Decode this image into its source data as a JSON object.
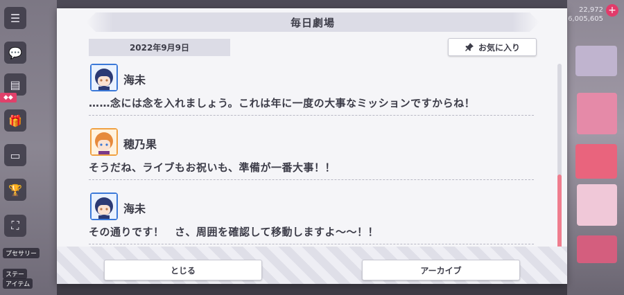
{
  "dialog": {
    "title": "毎日劇場",
    "date": "2022年9月9日",
    "favorite_label": "お気に入り",
    "close_label": "とじる",
    "archive_label": "アーカイブ"
  },
  "entries": [
    {
      "speaker": "海未",
      "text": "……念には念を入れましょう。これは年に一度の大事なミッションですからね！",
      "avatar": "umi-avatar"
    },
    {
      "speaker": "穂乃果",
      "text": "そうだね、ライブもお祝いも、準備が一番大事！！",
      "avatar": "honoka-avatar"
    },
    {
      "speaker": "海未",
      "text": "その通りです！　さ、周囲を確認して移動しますよ～～！！",
      "avatar": "umi-avatar"
    }
  ],
  "background": {
    "counter_top": "22,972",
    "counter_bottom": "6,005,605",
    "side_labels": [
      "プセサリー",
      "ステー",
      "アイテム"
    ]
  },
  "colors": {
    "accent": "#ef7d8e",
    "plus": "#e23b6a"
  }
}
